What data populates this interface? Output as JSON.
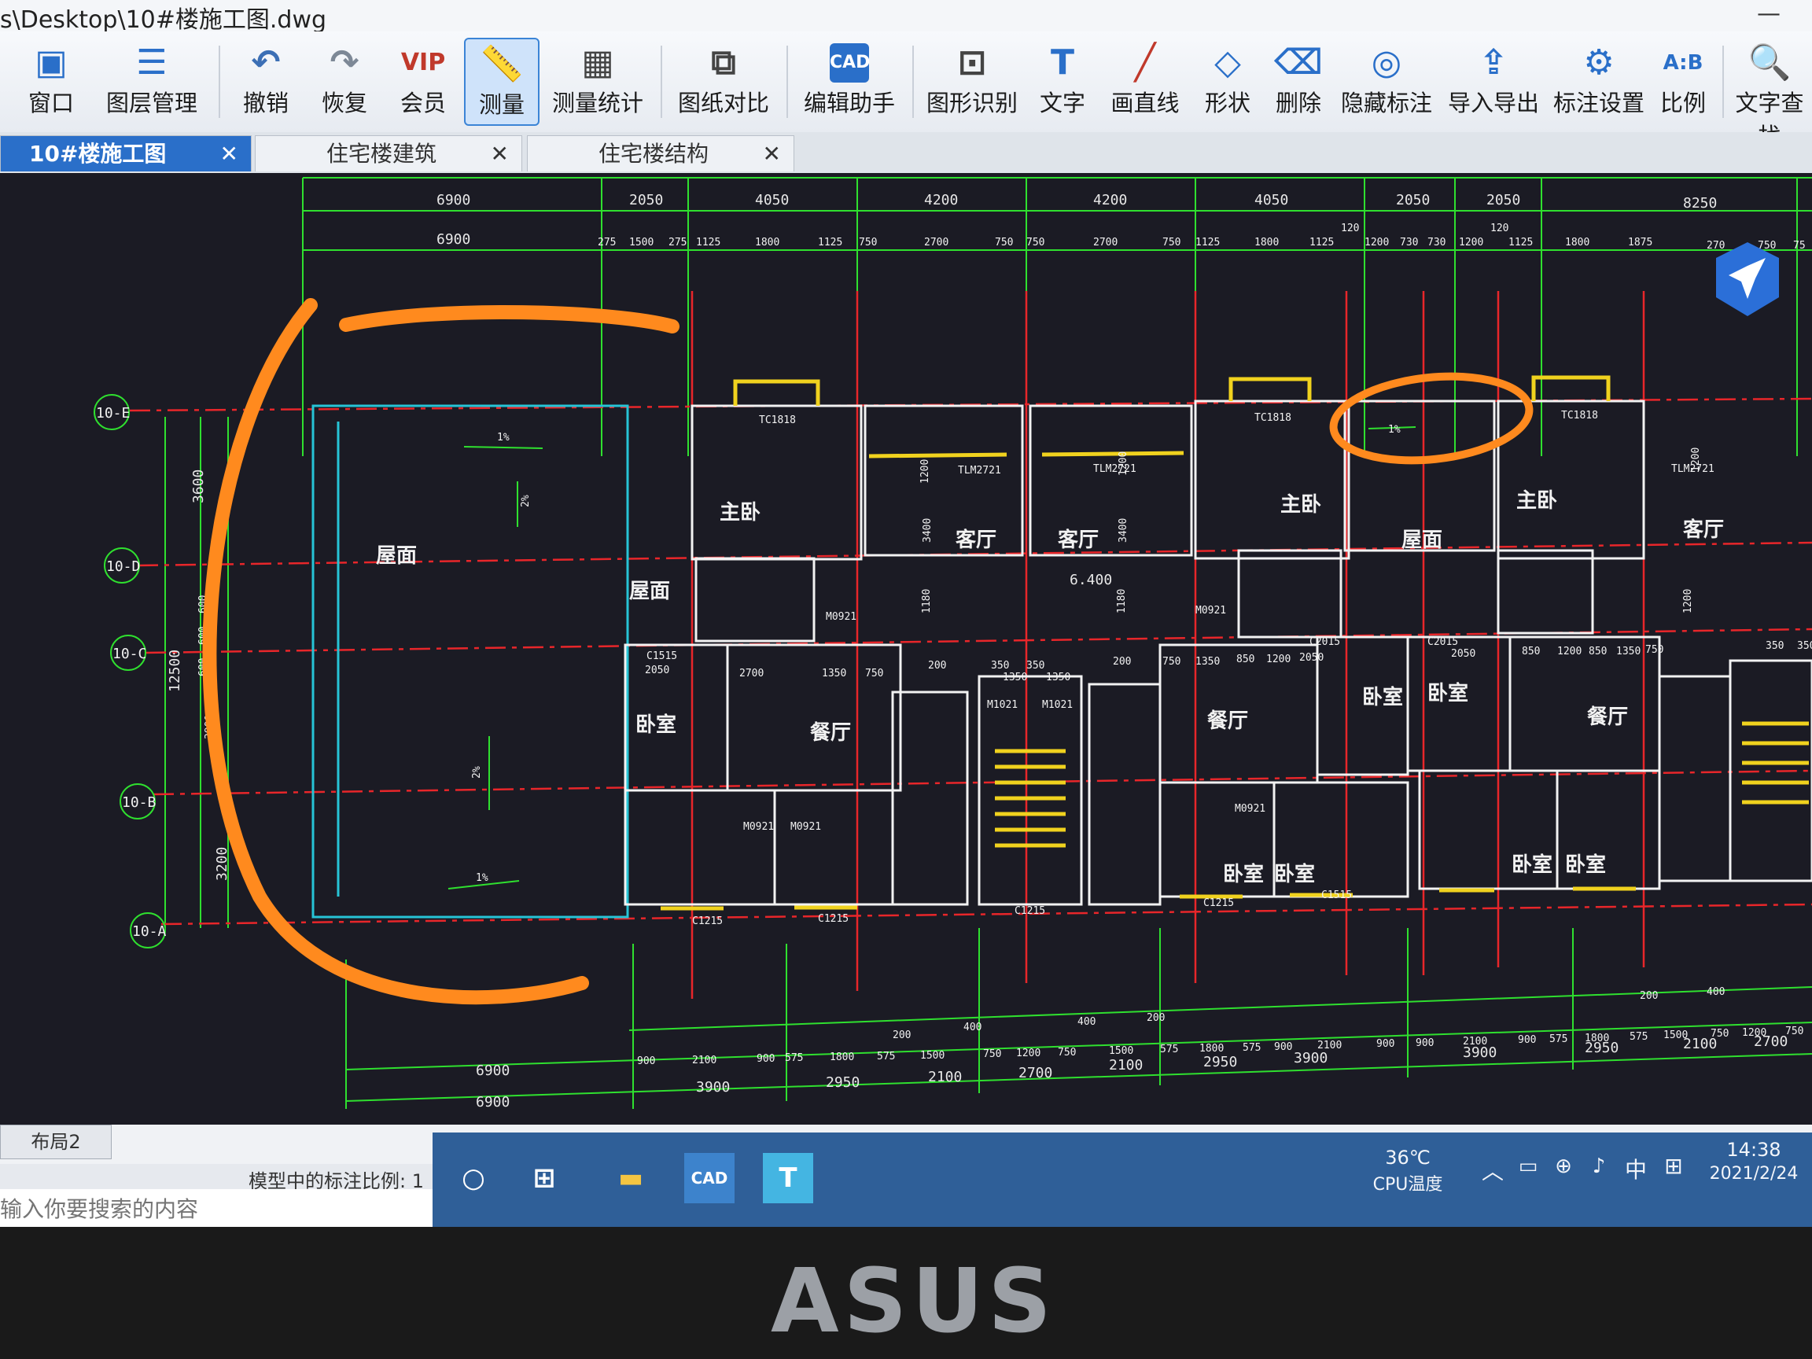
{
  "window": {
    "title": "s\\Desktop\\10#楼施工图.dwg",
    "controls": "—"
  },
  "toolbar": [
    {
      "label": "窗口",
      "icon": "window-icon"
    },
    {
      "label": "图层管理",
      "icon": "layers-icon"
    },
    {
      "label": "撤销",
      "icon": "undo-icon"
    },
    {
      "label": "恢复",
      "icon": "redo-icon"
    },
    {
      "label": "会员",
      "icon": "vip-icon",
      "glyph": "VIP"
    },
    {
      "label": "测量",
      "icon": "ruler-icon",
      "active": true
    },
    {
      "label": "测量统计",
      "icon": "measure-stats-icon"
    },
    {
      "label": "图纸对比",
      "icon": "compare-icon"
    },
    {
      "label": "编辑助手",
      "icon": "edit-assistant-icon",
      "glyph": "CAD"
    },
    {
      "label": "图形识别",
      "icon": "shape-recognition-icon"
    },
    {
      "label": "文字",
      "icon": "text-icon",
      "glyph": "T"
    },
    {
      "label": "画直线",
      "icon": "line-icon"
    },
    {
      "label": "形状",
      "icon": "shape-icon"
    },
    {
      "label": "删除",
      "icon": "eraser-icon"
    },
    {
      "label": "隐藏标注",
      "icon": "hide-annotation-icon"
    },
    {
      "label": "导入导出",
      "icon": "import-export-icon"
    },
    {
      "label": "标注设置",
      "icon": "annotation-settings-icon"
    },
    {
      "label": "比例",
      "icon": "scale-icon",
      "glyph": "A:B"
    },
    {
      "label": "文字查找",
      "icon": "text-search-icon"
    }
  ],
  "tabs": [
    {
      "label": "10#楼施工图",
      "active": true
    },
    {
      "label": "住宅楼建筑",
      "active": false
    },
    {
      "label": "住宅楼结构",
      "active": false
    }
  ],
  "drawing": {
    "top_dims_row1": [
      "6900",
      "2050",
      "4050",
      "4200",
      "4200",
      "4050",
      "2050",
      "2050",
      "8250"
    ],
    "top_dims_row2": [
      "6900",
      "275",
      "1500",
      "275",
      "1125",
      "1800",
      "1125",
      "750",
      "2700",
      "750",
      "750",
      "2700",
      "750",
      "1125",
      "1800",
      "1125",
      "1200",
      "730",
      "730",
      "1200",
      "1125",
      "1800",
      "1875",
      "270",
      "750",
      "75"
    ],
    "top_dims_small": [
      "120",
      "120"
    ],
    "axis_labels": [
      "10-E",
      "10-D",
      "10-C",
      "10-B",
      "10-A"
    ],
    "left_dims": [
      "3600",
      "600",
      "600",
      "600",
      "12500",
      "3900",
      "3200"
    ],
    "room_labels": [
      "主卧",
      "屋面",
      "屋面",
      "卧室",
      "餐厅",
      "客厅",
      "客厅",
      "主卧",
      "屋面",
      "主卧",
      "客厅",
      "餐厅",
      "卧室",
      "卧室",
      "餐厅",
      "卧室",
      "卧室",
      "卧室",
      "卧室"
    ],
    "elevation": "6.400",
    "slope": [
      "1%",
      "2%",
      "2%",
      "1%",
      "1%"
    ],
    "mid_dims": [
      "2050",
      "2700",
      "1350",
      "750",
      "2050",
      "2050",
      "750",
      "1350",
      "850",
      "1200",
      "850",
      "1200",
      "850",
      "1350",
      "750",
      "350",
      "350",
      "350",
      "350",
      "200",
      "200",
      "1350",
      "1350",
      "1200",
      "3400",
      "3400",
      "1200",
      "1200",
      "1200",
      "1180",
      "1180"
    ],
    "door_labels": [
      "TC1818",
      "TC1818",
      "TC1818",
      "M0921",
      "M0921",
      "M0921",
      "M0921",
      "M0921",
      "M1021",
      "M1021",
      "TLM2721",
      "TLM2721",
      "TLM2721",
      "C1515",
      "C1215",
      "C1215",
      "C1215",
      "C1215",
      "C1515",
      "C2015",
      "C2015"
    ],
    "bottom_dims_row1": [
      "900",
      "2100",
      "900",
      "575",
      "1800",
      "575",
      "1500",
      "750",
      "1200",
      "750",
      "1500",
      "575",
      "1800",
      "575",
      "900",
      "2100",
      "900",
      "900",
      "2100",
      "900",
      "575",
      "1800",
      "575",
      "1500",
      "750",
      "1200",
      "750"
    ],
    "bottom_dims_row2": [
      "6900",
      "3900",
      "2950",
      "2100",
      "2700",
      "2100",
      "2950",
      "3900",
      "3900",
      "2950",
      "2100",
      "2700"
    ],
    "bottom_dims_row3": [
      "6900"
    ],
    "bottom_dims_small": [
      "200",
      "400",
      "400",
      "200",
      "200",
      "400"
    ]
  },
  "layout_tab": "布局2",
  "status": {
    "scale_text": "模型中的标注比例: 1",
    "search_placeholder": "输入你要搜索的内容"
  },
  "taskbar": {
    "cpu_temp": "36℃",
    "cpu_label": "CPU温度",
    "ime": "中",
    "time": "14:38",
    "date": "2021/2/24"
  },
  "laptop_brand": "ASUS",
  "colors": {
    "active_tab": "#2a6fc9",
    "drawing_bg": "#1b1b24",
    "axis_lines": "#e8262a",
    "dims": "#2fe02f",
    "walls": "#f2f2f2",
    "windows": "#f0d21e",
    "annotation": "#ff8a1e"
  }
}
